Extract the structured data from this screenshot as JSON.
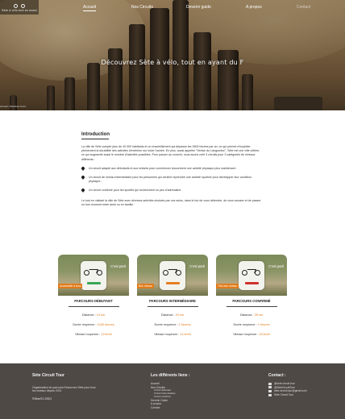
{
  "logo": {
    "text": "Sète à vélo tout en avant"
  },
  "nav": {
    "items": [
      {
        "label": "Accueil",
        "active": true
      },
      {
        "label": "Nos Circuits",
        "active": false
      },
      {
        "label": "Devenir guide",
        "active": false
      },
      {
        "label": "A propos",
        "active": false
      },
      {
        "label": "Contact",
        "active": false
      }
    ]
  },
  "hero": {
    "title": "Découvrez Sète à vélo, tout en ayant du F",
    "breadcrumb": "Accueil / Mobilites Tours"
  },
  "intro": {
    "heading": "Introduction",
    "paragraph": "La ville de Sète compte plus de 43 000 habitants et un ensoleillement qui dépasse les 2600 heures par an, ce qui permet d'exploiter pleinement la durabilité des activités d'extérieur sur toute l'année. En plus, aussi appelée \"Venise du Languedoc\", Sète est une ville côtière, ce qui augmente aussi le nombre d'activités possibles. Pour passer au concret, nous avons créé 3 circuits pour 3 catégories de niveaux différents :",
    "bullets": [
      "Un circuit adapté aux débutants et aux enfants pour commencer doucement une activité physique plus maintenant :",
      "Un circuit de niveau intermédiaire pour les personnes qui veulent reprendre une activité sportive pour développer leur condition physique ;",
      "Un circuit confirmé pour les sportifs qui recherchent un peu d'adrénaline."
    ],
    "closing": "Le tout en visitant la ville de Sète avec diverses activités choisies par nos soins, dans le but de vous détendre, de vous amuser et de passer un bon moment entre amis ou en famille."
  },
  "cards": [
    {
      "badge": "C'est parti",
      "level": "Accessible à tous",
      "level_color": "#e07b1a",
      "stripe_color": "#3aa655",
      "title": "PARCOURS DÉBUTANT",
      "distance_label": "Distance :",
      "distance": "10 km",
      "duration_label": "Durée moyenne :",
      "duration": "1h30 heures",
      "speed_label": "Vitesse moyenne :",
      "speed": "10 km/h"
    },
    {
      "badge": "C'est parti",
      "level": "Bon niveau",
      "level_color": "#e07b1a",
      "stripe_color": "#e67e22",
      "title": "PARCOURS INTERMÉDIAIRE",
      "distance_label": "Distance :",
      "distance": "20 km",
      "duration_label": "Durée moyenne :",
      "duration": "2 heures",
      "speed_label": "Vitesse moyenne :",
      "speed": "14 km/h"
    },
    {
      "badge": "C'est parti",
      "level": "Très bon niveau",
      "level_color": "#e07b1a",
      "stripe_color": "#d0312d",
      "title": "PARCOURS CONFIRMÉ",
      "distance_label": "Distance :",
      "distance": "35 km",
      "duration_label": "Durée moyenne :",
      "duration": "2 heures",
      "speed_label": "Vitesse moyenne :",
      "speed": "18 km/h"
    }
  ],
  "footer": {
    "col1": {
      "title": "Sète Circuit Tour",
      "desc": "Organisateur de parcours Découvrez Sète pour tous les niveaux depuis 2021",
      "copy": "©MonSJ 2021"
    },
    "col2": {
      "title": "Les différents liens :",
      "links": [
        {
          "label": "Accueil",
          "sub": false
        },
        {
          "label": "Nos Circuits",
          "sub": false
        },
        {
          "label": "Circuit débutant",
          "sub": true
        },
        {
          "label": "Circuit intermédiaire",
          "sub": true
        },
        {
          "label": "Circuit confirmé",
          "sub": true
        },
        {
          "label": "Devenir Guide",
          "sub": false
        },
        {
          "label": "A propos",
          "sub": false
        },
        {
          "label": "Contact",
          "sub": false
        }
      ]
    },
    "col3": {
      "title": "Contact :",
      "items": [
        {
          "icon": "instagram-icon",
          "label": "@sete.circuit.tour"
        },
        {
          "icon": "twitter-icon",
          "label": "@SeteCircuitTour"
        },
        {
          "icon": "mail-icon",
          "label": "sete.circuit.tour@gmail.com"
        },
        {
          "icon": "youtube-icon",
          "label": "Sète Circuit Tour"
        }
      ]
    }
  }
}
